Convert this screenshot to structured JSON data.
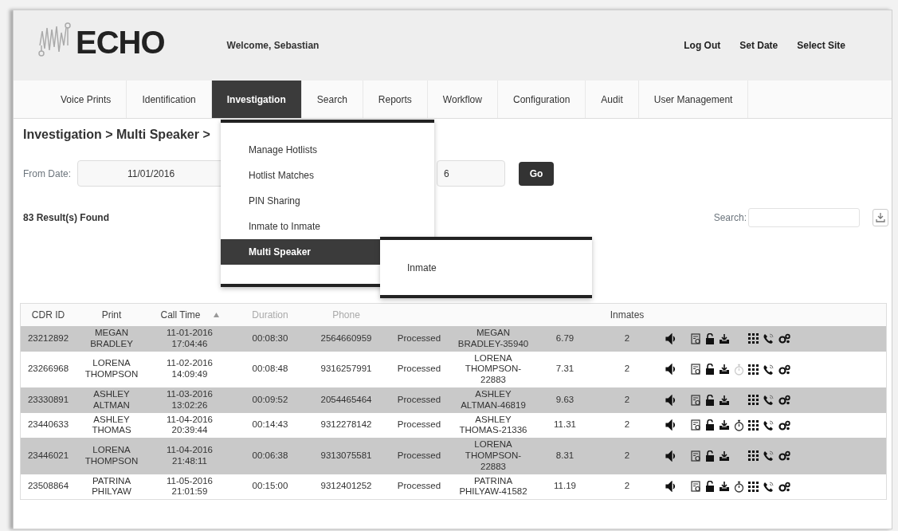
{
  "header": {
    "logo_text": "ECHO",
    "welcome": "Welcome, Sebastian",
    "links": [
      "Log Out",
      "Set Date",
      "Select Site"
    ]
  },
  "tabs": [
    {
      "label": "Voice Prints",
      "selected": false
    },
    {
      "label": "Identification",
      "selected": false
    },
    {
      "label": "Investigation",
      "selected": true
    },
    {
      "label": "Search",
      "selected": false
    },
    {
      "label": "Reports",
      "selected": false
    },
    {
      "label": "Workflow",
      "selected": false
    },
    {
      "label": "Configuration",
      "selected": false
    },
    {
      "label": "Audit",
      "selected": false
    },
    {
      "label": "User Management",
      "selected": false
    }
  ],
  "dropdown": {
    "items": [
      {
        "label": "Manage Hotlists",
        "selected": false
      },
      {
        "label": "Hotlist Matches",
        "selected": false
      },
      {
        "label": "PIN Sharing",
        "selected": false
      },
      {
        "label": "Inmate to Inmate",
        "selected": false
      },
      {
        "label": "Multi Speaker",
        "selected": true
      }
    ],
    "submenu": {
      "items": [
        {
          "label": "Inmate",
          "selected": false
        }
      ]
    }
  },
  "breadcrumb": "Investigation > Multi Speaker >",
  "filter": {
    "from_label": "From Date:",
    "from_value": "11/01/2016",
    "to_value": "6",
    "go": "Go"
  },
  "results": "83 Result(s) Found",
  "search": {
    "label": "Search:"
  },
  "table": {
    "columns": [
      {
        "label": "CDR ID",
        "dimmed": false,
        "sorted": false
      },
      {
        "label": "Print",
        "dimmed": false,
        "sorted": false
      },
      {
        "label": "Call Time",
        "dimmed": false,
        "sorted": true
      },
      {
        "label": "Duration",
        "dimmed": true,
        "sorted": false
      },
      {
        "label": "Phone",
        "dimmed": true,
        "sorted": false
      },
      {
        "label": "Inmates",
        "dimmed": false,
        "sorted": false
      }
    ],
    "rows": [
      {
        "cdr_id": "23212892",
        "print": "MEGAN BRADLEY",
        "call_time": "11-01-2016 17:04:46",
        "duration": "00:08:30",
        "phone": "2564660959",
        "status": "Processed",
        "speaker": "MEGAN BRADLEY-35940",
        "score": "6.79",
        "inmates": "2",
        "stopwatch": false,
        "stopwatch_dim": false
      },
      {
        "cdr_id": "23266968",
        "print": "LORENA THOMPSON",
        "call_time": "11-02-2016 14:09:49",
        "duration": "00:08:48",
        "phone": "9316257991",
        "status": "Processed",
        "speaker": "LORENA THOMPSON-22883",
        "score": "7.31",
        "inmates": "2",
        "stopwatch": true,
        "stopwatch_dim": true
      },
      {
        "cdr_id": "23330891",
        "print": "ASHLEY ALTMAN",
        "call_time": "11-03-2016 13:02:26",
        "duration": "00:09:52",
        "phone": "2054465464",
        "status": "Processed",
        "speaker": "ASHLEY ALTMAN-46819",
        "score": "9.63",
        "inmates": "2",
        "stopwatch": false,
        "stopwatch_dim": false
      },
      {
        "cdr_id": "23440633",
        "print": "ASHLEY THOMAS",
        "call_time": "11-04-2016 20:39:44",
        "duration": "00:14:43",
        "phone": "9312278142",
        "status": "Processed",
        "speaker": "ASHLEY THOMAS-21336",
        "score": "11.31",
        "inmates": "2",
        "stopwatch": true,
        "stopwatch_dim": false
      },
      {
        "cdr_id": "23446021",
        "print": "LORENA THOMPSON",
        "call_time": "11-04-2016 21:48:11",
        "duration": "00:06:38",
        "phone": "9313075581",
        "status": "Processed",
        "speaker": "LORENA THOMPSON-22883",
        "score": "8.31",
        "inmates": "2",
        "stopwatch": false,
        "stopwatch_dim": false
      },
      {
        "cdr_id": "23508864",
        "print": "PATRINA PHILYAW",
        "call_time": "11-05-2016 21:01:59",
        "duration": "00:15:00",
        "phone": "9312401252",
        "status": "Processed",
        "speaker": "PATRINA PHILYAW-41582",
        "score": "11.19",
        "inmates": "2",
        "stopwatch": true,
        "stopwatch_dim": false
      }
    ]
  }
}
